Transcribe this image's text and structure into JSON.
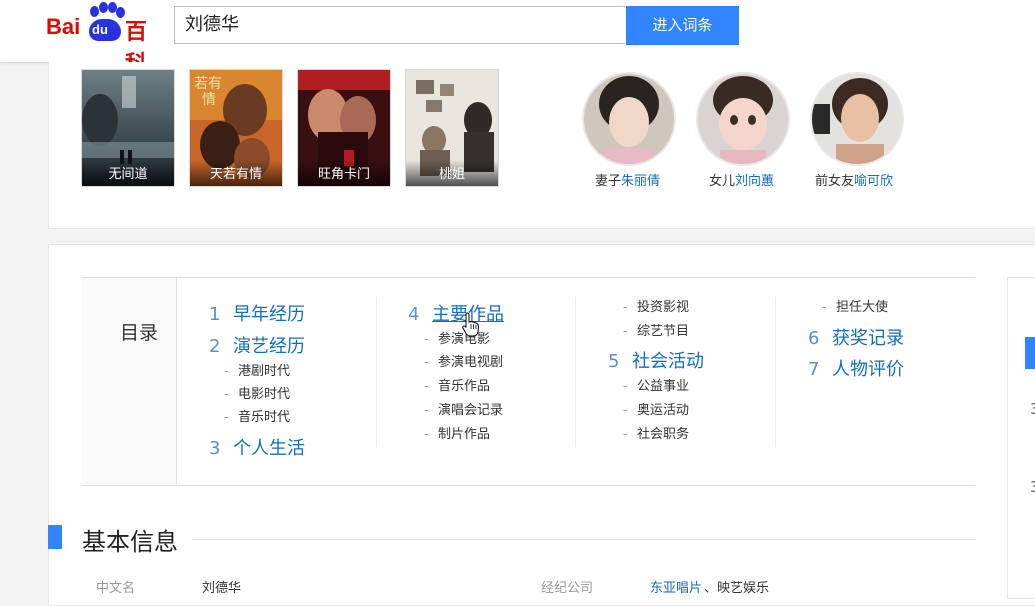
{
  "header": {
    "logo": {
      "bai": "Bai",
      "du": "du",
      "baike": "百科"
    },
    "search_value": "刘德华",
    "search_button": "进入词条"
  },
  "posters": [
    {
      "caption": "无间道"
    },
    {
      "caption": "天若有情"
    },
    {
      "caption": "旺角卡门"
    },
    {
      "caption": "桃姐"
    }
  ],
  "relations": [
    {
      "role": "妻子",
      "name": "朱丽倩"
    },
    {
      "role": "女儿",
      "name": "刘向蕙"
    },
    {
      "role": "前女友",
      "name": "喻可欣"
    }
  ],
  "catalog": {
    "title": "目录",
    "col1": {
      "s1": {
        "num": "1",
        "label": "早年经历"
      },
      "s2": {
        "num": "2",
        "label": "演艺经历"
      },
      "s2_sub": [
        "港剧时代",
        "电影时代",
        "音乐时代"
      ],
      "s3": {
        "num": "3",
        "label": "个人生活"
      }
    },
    "col2": {
      "s4": {
        "num": "4",
        "label": "主要作品"
      },
      "s4_sub": [
        "参演电影",
        "参演电视剧",
        "音乐作品",
        "演唱会记录",
        "制片作品"
      ]
    },
    "col3": {
      "top_sub": [
        "投资影视",
        "综艺节目"
      ],
      "s5": {
        "num": "5",
        "label": "社会活动"
      },
      "s5_sub": [
        "公益事业",
        "奥运活动",
        "社会职务"
      ]
    },
    "col4": {
      "top_sub": [
        "担任大使"
      ],
      "s6": {
        "num": "6",
        "label": "获奖记录"
      },
      "s7": {
        "num": "7",
        "label": "人物评价"
      }
    }
  },
  "basic_info": {
    "title": "基本信息",
    "row": {
      "label1": "中文名",
      "value1": "刘德华",
      "label2": "经纪公司",
      "value2_link": "东亚唱片",
      "value2_rest": "、映艺娱乐"
    }
  },
  "side": {
    "texts": [
      "3",
      "3"
    ]
  },
  "colors": {
    "accent": "#3385ff",
    "link": "#136ec2",
    "logo_red": "#e10602",
    "logo_blue": "#2932e1"
  }
}
